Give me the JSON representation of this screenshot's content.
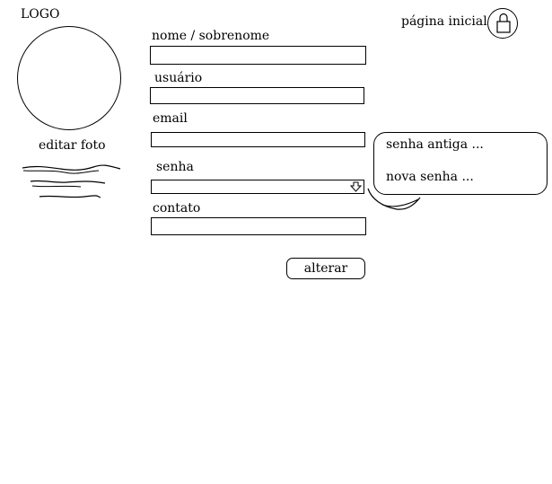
{
  "header": {
    "logo": "LOGO",
    "home_link": "página inicial",
    "logout_icon": "lock-icon"
  },
  "profile": {
    "edit_photo": "editar foto"
  },
  "form": {
    "name_label": "nome / sobrenome",
    "name_value": "",
    "username_label": "usuário",
    "username_value": "",
    "email_label": "email",
    "email_value": "",
    "password_label": "senha",
    "password_selected": "",
    "contact_label": "contato",
    "contact_value": "",
    "submit": "alterar"
  },
  "password_menu": {
    "items": [
      "senha antiga ...",
      "nova senha ..."
    ]
  }
}
